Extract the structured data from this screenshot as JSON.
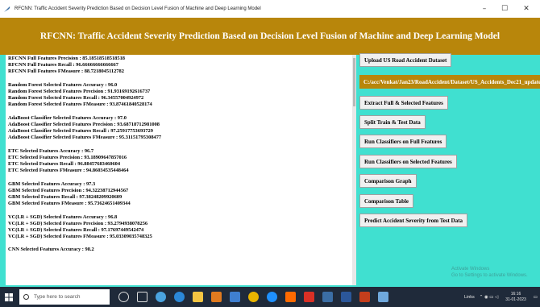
{
  "window": {
    "title": "RFCNN: Traffic Accident Severity Prediction Based on Decision Level Fusion of Machine and Deep Learning Model",
    "minimize": "–",
    "maximize": "☐",
    "close": "✕"
  },
  "banner": {
    "title": "RFCNN: Traffic Accident Severity Prediction Based on Decision Level Fusion of Machine and Deep Learning Model"
  },
  "output_lines": [
    "RFCNN Full Features Precision : 85.18518518518518",
    "RFCNN Full Features Recall    : 96.66666666666667",
    "RFCNN Full Features FMeasure   : 88.7218045112782",
    "",
    "Random Forest Selected Features Accuracy : 96.0",
    "Random Forest Selected Features Precision : 91.93169192616737",
    "Random Forest Selected Features Recall    : 96.34557004924972",
    "Random Forest Selected Features FMeasure  : 93.87461840528174",
    "",
    "AdaBoost Classifier Selected Features Accuracy : 97.0",
    "AdaBoost Classifier Selected Features Precision : 93.68718712981008",
    "AdaBoost Classifier Selected Features Recall    : 97.25917753693729",
    "AdaBoost Classifier Selected Features FMeasure  : 95.31151795308477",
    "",
    "ETC Selected Features Accuracy : 96.7",
    "ETC Selected Features Precision : 93.18909647857016",
    "ETC Selected Features Recall    : 96.88457683460604",
    "ETC Selected Features FMeasure  : 94.86034535448464",
    "",
    "GBM Selected Features Accuracy : 97.3",
    "GBM Selected Features Precision : 94.32238712944567",
    "GBM Selected Features Recall    : 97.38248209920609",
    "GBM Selected Features FMeasure  : 95.73624651409344",
    "",
    "VC(LR + SGD) Selected Features Accuracy : 96.8",
    "VC(LR + SGD) Selected Features Precision : 93.2794938078256",
    "VC(LR + SGD) Selected Features Recall    : 97.17697449542474",
    "VC(LR + SGD) Selected Features FMeasure  : 95.03309035748325",
    "",
    "CNN Selected Features Accuracy : 98.2"
  ],
  "buttons": {
    "upload": "Upload US Road Accident Dataset",
    "path": "C:/acc/Venkat/Jan23/RoadAccident/Dataset/US_Accidents_Dec21_updated.csv",
    "extract": "Extract Full & Selected Features",
    "split": "Split Train & Test Data",
    "run_full": "Run Classifiers on Full Features",
    "run_selected": "Run Classifiers on Selected Features",
    "graph": "Comparison Graph",
    "table": "Comparison Table",
    "predict": "Predict Accident Severity from Test Data"
  },
  "watermark": {
    "line1": "Activate Windows",
    "line2": "Go to Settings to activate Windows."
  },
  "taskbar": {
    "search_placeholder": "Type here to search",
    "links_label": "Links",
    "time": "16:16",
    "date": "31-01-2023"
  },
  "colors": {
    "background": "#40e0d0",
    "banner": "#b8860b",
    "taskbar": "#1f2a3a"
  }
}
